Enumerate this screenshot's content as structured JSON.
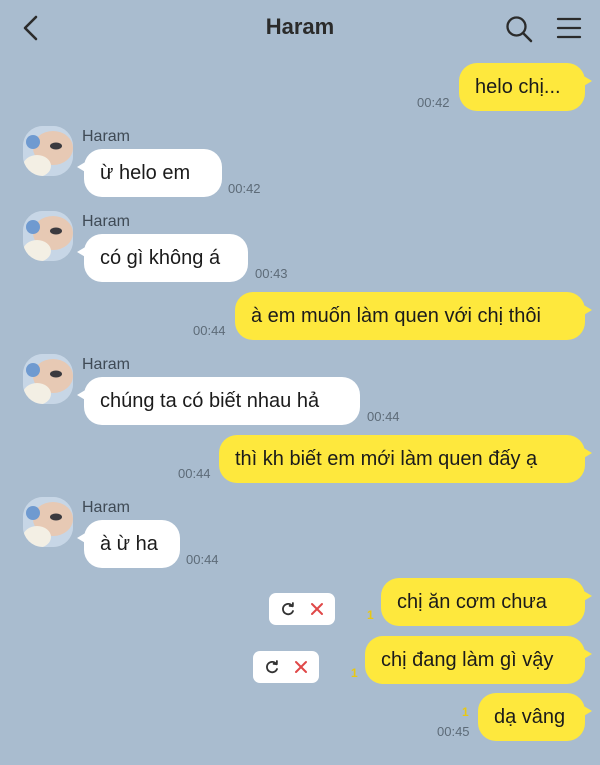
{
  "header": {
    "title": "Haram"
  },
  "contact": {
    "name": "Haram"
  },
  "messages": [
    {
      "text": "helo chị...",
      "time": "00:42"
    },
    {
      "text": "ừ helo em",
      "time": "00:42"
    },
    {
      "text": "có gì không á",
      "time": "00:43"
    },
    {
      "text": "à em muốn làm quen với chị thôi",
      "time": "00:44"
    },
    {
      "text": "chúng ta có biết nhau hả",
      "time": "00:44"
    },
    {
      "text": "thì kh biết em mới làm quen đấy ạ",
      "time": "00:44"
    },
    {
      "text": "à ừ ha",
      "time": "00:44"
    },
    {
      "text": "chị ăn cơm chưa",
      "unread": "1"
    },
    {
      "text": "chị đang làm gì vậy",
      "unread": "1"
    },
    {
      "text": "dạ vâng",
      "time": "00:45",
      "unread": "1"
    }
  ],
  "colors": {
    "background": "#a9bccf",
    "outgoing": "#fee83d",
    "incoming": "#ffffff",
    "unread": "#e8c814",
    "cancel": "#e04848"
  },
  "icons": {
    "back": "chevron-left-icon",
    "search": "search-icon",
    "menu": "hamburger-menu-icon",
    "resend": "refresh-icon",
    "cancel": "close-icon"
  }
}
